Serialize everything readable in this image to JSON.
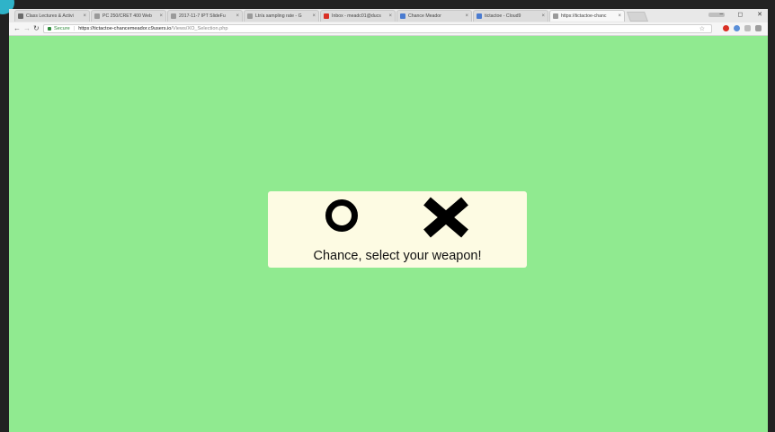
{
  "tabs": [
    {
      "title": "Class Lectures & Activi",
      "favicon_color": "#6b6b6b",
      "active": false
    },
    {
      "title": "PC 250/CRET 400 Web",
      "favicon_color": "#9a9a9a",
      "active": false
    },
    {
      "title": "2017-11-7 IPT SlideFu",
      "favicon_color": "#9a9a9a",
      "active": false
    },
    {
      "title": "Ltr/a sampling rate - G",
      "favicon_color": "#9a9a9a",
      "active": false
    },
    {
      "title": "Inbox - meadc01@ducs",
      "favicon_color": "#d93025",
      "active": false
    },
    {
      "title": "Chance Meador",
      "favicon_color": "#4a7bd0",
      "active": false
    },
    {
      "title": "tictactoe - Cloud9",
      "favicon_color": "#4a7bd0",
      "active": false
    },
    {
      "title": "https://tictactoe-chanc",
      "favicon_color": "#9a9a9a",
      "active": true
    }
  ],
  "toolbar": {
    "secure_label": "Secure",
    "url_host": "https://tictactoe-chancemeador.c9users.io",
    "url_path": "/Views/XO_Selection.php"
  },
  "window_controls": {
    "minimize": "–",
    "maximize": "◻",
    "close": "✕"
  },
  "content": {
    "prompt": "Chance, select your weapon!",
    "weapons": [
      "O",
      "X"
    ]
  },
  "colors": {
    "page_background": "#90ea90",
    "card_background": "#fdfbe3"
  }
}
